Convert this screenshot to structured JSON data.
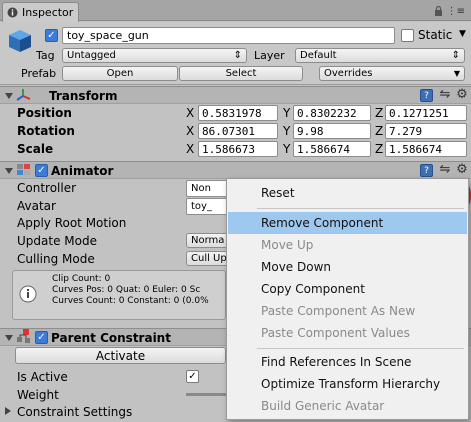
{
  "window": {
    "tab_title": "Inspector"
  },
  "header": {
    "object_name": "toy_space_gun",
    "static_label": "Static",
    "tag_label": "Tag",
    "tag_value": "Untagged",
    "layer_label": "Layer",
    "layer_value": "Default",
    "prefab_label": "Prefab",
    "open_label": "Open",
    "select_label": "Select",
    "overrides_label": "Overrides"
  },
  "transform": {
    "title": "Transform",
    "rows": [
      {
        "label": "Position",
        "x": "0.5831978",
        "y": "0.8302232",
        "z": "0.1271251"
      },
      {
        "label": "Rotation",
        "x": "86.07301",
        "y": "9.98",
        "z": "7.279"
      },
      {
        "label": "Scale",
        "x": "1.586673",
        "y": "1.586674",
        "z": "1.586674"
      }
    ],
    "axis": {
      "x": "X",
      "y": "Y",
      "z": "Z"
    }
  },
  "animator": {
    "title": "Animator",
    "controller_label": "Controller",
    "controller_value": "Non",
    "avatar_label": "Avatar",
    "avatar_value": "toy_",
    "apply_root_label": "Apply Root Motion",
    "update_mode_label": "Update Mode",
    "update_mode_value": "Norma",
    "culling_mode_label": "Culling Mode",
    "culling_mode_value": "Cull Up",
    "info": {
      "line1": "Clip Count: 0",
      "line2": "Curves Pos: 0 Quat: 0 Euler: 0 Sc",
      "line3": "Curves Count: 0 Constant: 0 (0.0%"
    }
  },
  "parent_constraint": {
    "title": "Parent Constraint",
    "activate_label": "Activate",
    "is_active_label": "Is Active",
    "weight_label": "Weight",
    "constraint_settings_label": "Constraint Settings"
  },
  "context_menu": {
    "items": [
      {
        "label": "Reset"
      },
      {
        "label": "Remove Component"
      },
      {
        "label": "Move Up"
      },
      {
        "label": "Move Down"
      },
      {
        "label": "Copy Component"
      },
      {
        "label": "Paste Component As New"
      },
      {
        "label": "Paste Component Values"
      },
      {
        "label": "Find References In Scene"
      },
      {
        "label": "Optimize Transform Hierarchy"
      },
      {
        "label": "Build Generic Avatar"
      }
    ]
  },
  "colors": {
    "highlight": "#9ec8ee",
    "annotation_circle": "#e02020",
    "checkbox_on": "#3d7bd8"
  }
}
